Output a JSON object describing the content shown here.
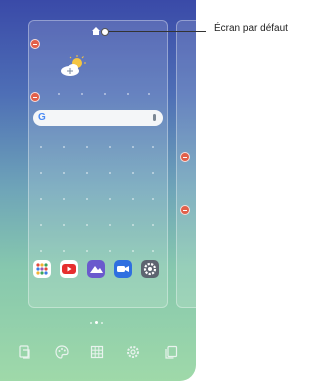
{
  "callout": {
    "label": "Écran par défaut"
  },
  "search_bar": {
    "logo_letter": "G"
  },
  "dock_apps": [
    {
      "name": "apps-folder"
    },
    {
      "name": "youtube"
    },
    {
      "name": "gallery"
    },
    {
      "name": "video-camera"
    },
    {
      "name": "settings"
    }
  ],
  "bottom_bar": [
    {
      "icon": "wallpaper-icon"
    },
    {
      "icon": "themes-icon"
    },
    {
      "icon": "widgets-grid-icon"
    },
    {
      "icon": "home-settings-gear-icon"
    },
    {
      "icon": "copy-page-icon"
    }
  ],
  "colors": {
    "remove_badge": "#e2604a",
    "youtube": "#e62e2e",
    "gallery": "#6a5acd",
    "camera": "#2f6fe0",
    "settings": "#5d6470"
  }
}
